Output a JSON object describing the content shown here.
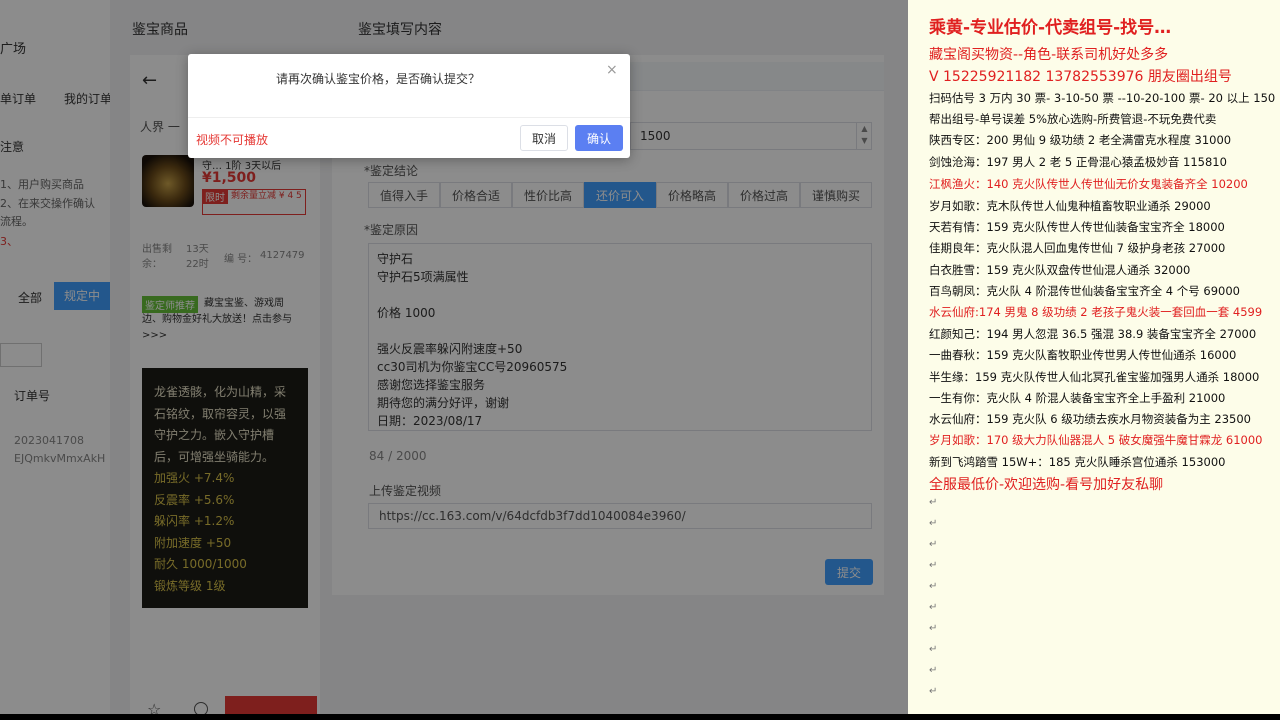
{
  "left_strip": {
    "items": [
      "广场",
      "单订单",
      "我的订单",
      "注意",
      "1、用户购买商品",
      "2、在来交操作确认",
      "流程。",
      "3、",
      "全部",
      "规定中",
      "订单号",
      "2023041708",
      "EJQmkvMmxAkH"
    ]
  },
  "goods": {
    "header": "鉴宝商品",
    "back_icon": "arrow-left-icon",
    "seller_line": "人界 一",
    "item_title": "守… 1阶 3天以后",
    "price": "¥1,500",
    "limit_tag": "限时",
    "limit_text": "剩余量立减 ¥ 4 5",
    "listed_label": "出售剩余：",
    "listed_value": "13天22时",
    "id_label": "编 号：",
    "id_value": "4127479",
    "promo_tag": "鉴定师推荐",
    "promo_text": "藏宝宝鉴、游戏周边、购物金好礼大放送！点击参与 >>>",
    "desc_lines": [
      "龙雀透骸，化为山精，采",
      "石铭纹，取帘容灵，以强",
      "守护之力。嵌入守护槽",
      "后，可增强坐骑能力。"
    ],
    "stat_lines": [
      "加强火 +7.4%",
      "反震率 +5.6%",
      "躲闪率 +1.2%",
      "附加速度 +50",
      "耐久 1000/1000",
      "锻炼等级 1级"
    ],
    "bottom_icons": [
      "star-icon",
      "info-icon"
    ]
  },
  "form": {
    "header": "鉴宝填写内容",
    "price_value": "1500",
    "conclusion_label": "*鉴定结论",
    "conclusions": [
      "值得入手",
      "价格合适",
      "性价比高",
      "还价可入",
      "价格略高",
      "价格过高",
      "谨慎购买"
    ],
    "active_conclusion": "还价可入",
    "reason_label": "*鉴定原因",
    "reason_lines": [
      "守护石",
      "守护石5项满属性",
      "",
      "价格 1000",
      "",
      "强火反震率躲闪附速度+50",
      "cc30司机为你鉴宝CC号20960575",
      "感谢您选择鉴宝服务",
      "期待您的满分好评，谢谢",
      "日期：2023/08/17"
    ],
    "char_count": "84 / 2000",
    "video_label": "上传鉴定视频",
    "video_url": "https://cc.163.com/v/64dcfdb3f7dd1040084e3960/",
    "submit": "提交"
  },
  "dialog": {
    "message": "请再次确认鉴宝价格，是否确认提交？",
    "close": "×",
    "video_warning": "视频不可播放",
    "cancel": "取消",
    "confirm": "确认"
  },
  "notes": {
    "title": "乘黄-专业估价-代卖组号-找号…",
    "lines": [
      {
        "text": "藏宝阁买物资--角色-联系司机好处多多",
        "style": "red-mid"
      },
      {
        "text": "V 15225921182   13782553976 朋友圈出组号",
        "style": "red-mid"
      },
      {
        "text": "扫码估号 3 万内 30 票- 3-10-50 票  --10-20-100 票- 20 以上 150",
        "style": "black"
      },
      {
        "text": "帮出组号-单号误差 5%放心选购-所费管退-不玩免费代卖",
        "style": "black"
      },
      {
        "text": "陕西专区：200 男仙 9 级功绩 2 老全满雷克水程度 31000",
        "style": "black"
      },
      {
        "text": "剑蚀沧海：197 男人 2 老 5 正骨混心猿孟极妙音 115810",
        "style": "black"
      },
      {
        "text": "江枫渔火：140 克火队传世人传世仙无价女鬼装备齐全 10200",
        "style": "red"
      },
      {
        "text": "岁月如歌：克木队传世人仙鬼种植畜牧职业通杀 29000",
        "style": "black"
      },
      {
        "text": "天若有情：159 克火队传世人传世仙装备宝宝齐全 18000",
        "style": "black"
      },
      {
        "text": "佳期良年：克火队混人回血鬼传世仙 7 级护身老孩 27000",
        "style": "black"
      },
      {
        "text": "白衣胜雪：159 克火队双盘传世仙混人通杀 32000",
        "style": "black"
      },
      {
        "text": "百鸟朝凤：克火队 4 阶混传世仙装备宝宝齐全 4 个号 69000",
        "style": "black"
      },
      {
        "text": "水云仙府:174 男鬼 8 级功绩 2 老孩子鬼火装一套回血一套 4599",
        "style": "red"
      },
      {
        "text": "红颜知己：194 男人忽混 36.5 强混 38.9 装备宝宝齐全 27000",
        "style": "black"
      },
      {
        "text": "一曲春秋：159 克火队畜牧职业传世男人传世仙通杀 16000",
        "style": "black"
      },
      {
        "text": "半生缘：159 克火队传世人仙北冥孔雀宝鉴加强男人通杀 18000",
        "style": "black"
      },
      {
        "text": "一生有你：克火队 4 阶混人装备宝宝齐全上手盈利 21000",
        "style": "black"
      },
      {
        "text": "水云仙府：159 克火队 6 级功绩去疾水月物资装备为主 23500",
        "style": "black"
      },
      {
        "text": "岁月如歌：170 级大力队仙器混人 5 破女魔强牛魔甘霖龙 61000",
        "style": "red"
      },
      {
        "text": "新到飞鸿踏雪 15W+：185 克火队睡杀宫位通杀 153000",
        "style": "black"
      },
      {
        "text": "全服最低价-欢迎选购-看号加好友私聊",
        "style": "red-mid"
      }
    ],
    "paragraph_mark": "↵"
  }
}
